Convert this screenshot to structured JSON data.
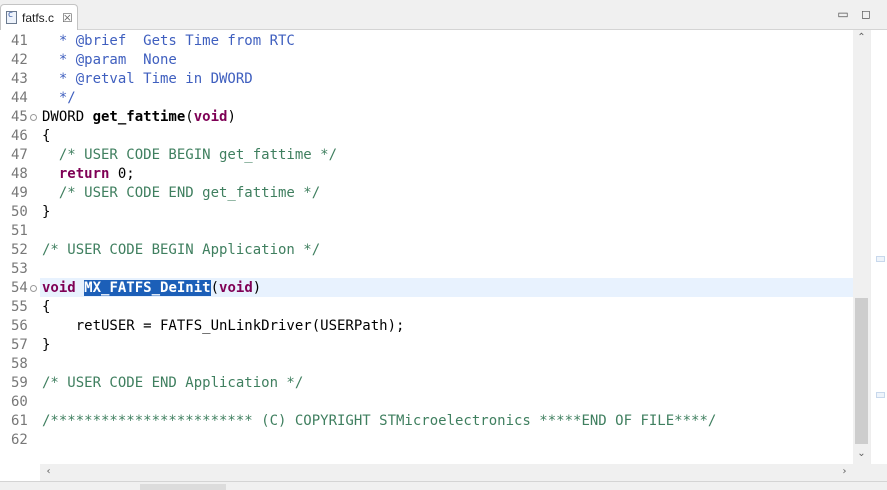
{
  "tab": {
    "filename": "fatfs.c",
    "file_icon": "c-source-file-icon",
    "close_glyph": "☒"
  },
  "window_controls": {
    "minimize_glyph": "▭",
    "maximize_glyph": "◻"
  },
  "colors": {
    "comment": "#3f7f5f",
    "doc_comment": "#3f5fbf",
    "keyword": "#7f0055",
    "selection": "#1c5fb8",
    "current_line": "#e8f2fe"
  },
  "lines": [
    {
      "number": "41",
      "tokens": [
        {
          "t": "  * @brief  Gets Time from RTC",
          "c": "doc"
        }
      ]
    },
    {
      "number": "42",
      "tokens": [
        {
          "t": "  * @param  None",
          "c": "doc"
        }
      ]
    },
    {
      "number": "43",
      "tokens": [
        {
          "t": "  * @retval Time in DWORD",
          "c": "doc"
        }
      ]
    },
    {
      "number": "44",
      "tokens": [
        {
          "t": "  */",
          "c": "doc"
        }
      ]
    },
    {
      "number": "45",
      "fold": true,
      "tokens": [
        {
          "t": "DWORD ",
          "c": ""
        },
        {
          "t": "get_fattime",
          "c": "fn"
        },
        {
          "t": "(",
          "c": ""
        },
        {
          "t": "void",
          "c": "kw"
        },
        {
          "t": ")",
          "c": ""
        }
      ]
    },
    {
      "number": "46",
      "tokens": [
        {
          "t": "{",
          "c": ""
        }
      ]
    },
    {
      "number": "47",
      "tokens": [
        {
          "t": "  /* USER CODE BEGIN get_fattime */",
          "c": "cmt"
        }
      ]
    },
    {
      "number": "48",
      "tokens": [
        {
          "t": "  ",
          "c": ""
        },
        {
          "t": "return",
          "c": "kw"
        },
        {
          "t": " 0;",
          "c": ""
        }
      ]
    },
    {
      "number": "49",
      "tokens": [
        {
          "t": "  /* USER CODE END get_fattime */",
          "c": "cmt"
        }
      ]
    },
    {
      "number": "50",
      "tokens": [
        {
          "t": "}",
          "c": ""
        }
      ]
    },
    {
      "number": "51",
      "tokens": []
    },
    {
      "number": "52",
      "tokens": [
        {
          "t": "/* USER CODE BEGIN Application */",
          "c": "cmt"
        }
      ]
    },
    {
      "number": "53",
      "tokens": []
    },
    {
      "number": "54",
      "fold": true,
      "current": true,
      "tokens": [
        {
          "t": "void",
          "c": "kw"
        },
        {
          "t": " ",
          "c": ""
        },
        {
          "t": "MX_FATFS_DeInit",
          "c": "sel"
        },
        {
          "t": "(",
          "c": ""
        },
        {
          "t": "void",
          "c": "kw"
        },
        {
          "t": ")",
          "c": ""
        }
      ]
    },
    {
      "number": "55",
      "tokens": [
        {
          "t": "{",
          "c": ""
        }
      ]
    },
    {
      "number": "56",
      "tokens": [
        {
          "t": "    retUSER = FATFS_UnLinkDriver(USERPath);",
          "c": ""
        }
      ]
    },
    {
      "number": "57",
      "tokens": [
        {
          "t": "}",
          "c": ""
        }
      ]
    },
    {
      "number": "58",
      "tokens": []
    },
    {
      "number": "59",
      "tokens": [
        {
          "t": "/* USER CODE END Application */",
          "c": "cmt"
        }
      ]
    },
    {
      "number": "60",
      "tokens": []
    },
    {
      "number": "61",
      "tokens": [
        {
          "t": "/************************ (C) COPYRIGHT STMicroelectronics *****END OF FILE****/",
          "c": "cmt"
        }
      ]
    },
    {
      "number": "62",
      "tokens": []
    }
  ],
  "scroll": {
    "up_glyph": "⌃",
    "down_glyph": "⌄",
    "left_glyph": "‹",
    "right_glyph": "›"
  }
}
